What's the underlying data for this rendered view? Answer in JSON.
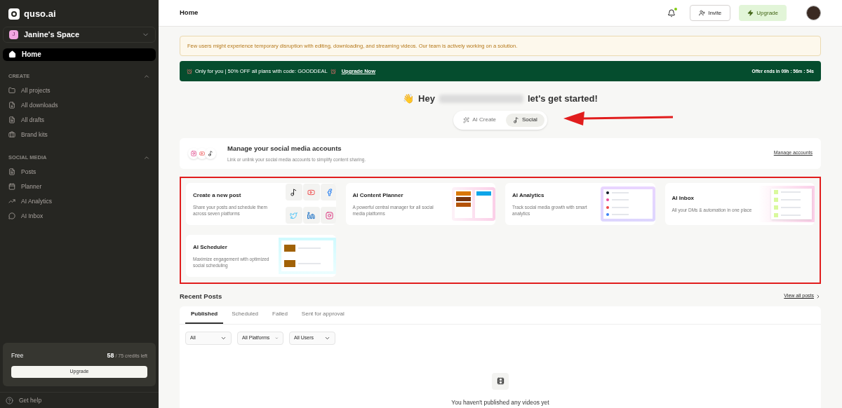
{
  "sidebar": {
    "logo": "quso.ai",
    "workspace": {
      "initial": "J",
      "name": "Janine's Space"
    },
    "home": {
      "label": "Home",
      "selected": true
    },
    "sections": [
      {
        "title": "CREATE",
        "expanded": true,
        "items": [
          {
            "label": "All projects"
          },
          {
            "label": "All downloads"
          },
          {
            "label": "All drafts"
          },
          {
            "label": "Brand kits"
          }
        ]
      },
      {
        "title": "SOCIAL MEDIA",
        "expanded": true,
        "items": [
          {
            "label": "Posts"
          },
          {
            "label": "Planner"
          },
          {
            "label": "AI Analytics"
          },
          {
            "label": "AI Inbox"
          }
        ]
      }
    ],
    "plan": {
      "name": "Free",
      "credits": "58",
      "credits_total": "/ 75 credits left",
      "button": "Upgrade"
    },
    "help": "Get help"
  },
  "header": {
    "title": "Home",
    "notification_dot": true,
    "invite": "Invite",
    "upgrade": "Upgrade"
  },
  "notice": "Few users might experience temporary disruption with editing, downloading, and streaming videos. Our team is actively working on a solution.",
  "promo": {
    "text": "Only for you | 50% OFF all plans with code: GOODDEAL",
    "link": "Upgrade Now",
    "timer": "Offer ends in 09h : 56m : 54s"
  },
  "greeting": {
    "emoji": "👋",
    "before": "Hey",
    "after": "let's get started!"
  },
  "mode_tabs": [
    {
      "label": "AI Create",
      "selected": false
    },
    {
      "label": "Social",
      "selected": true
    }
  ],
  "accounts": {
    "title": "Manage your social media accounts",
    "subtitle": "Link or unlink your social media accounts to simplify content sharing.",
    "link": "Manage accounts"
  },
  "features": [
    {
      "title": "Create a new post",
      "description": "Share your posts and schedule them across seven platforms",
      "kind": "icons"
    },
    {
      "title": "AI Content Planner",
      "description": "A powerful central manager for all social media platforms",
      "kind": "planner"
    },
    {
      "title": "AI Analytics",
      "description": "Track social media growth with smart analytics",
      "kind": "analytics"
    },
    {
      "title": "AI Inbox",
      "description": "All your DMs & automation in one place",
      "kind": "inbox"
    },
    {
      "title": "AI Scheduler",
      "description": "Maximize engagement with optimized social scheduling",
      "kind": "scheduler"
    }
  ],
  "recent": {
    "title": "Recent Posts",
    "view_all": "View all posts",
    "tabs": [
      {
        "label": "Published",
        "selected": true
      },
      {
        "label": "Scheduled",
        "selected": false
      },
      {
        "label": "Failed",
        "selected": false
      },
      {
        "label": "Sent for approval",
        "selected": false
      }
    ],
    "filters": [
      "All",
      "All Platforms",
      "All Users"
    ],
    "empty": "You haven't published any videos yet"
  }
}
